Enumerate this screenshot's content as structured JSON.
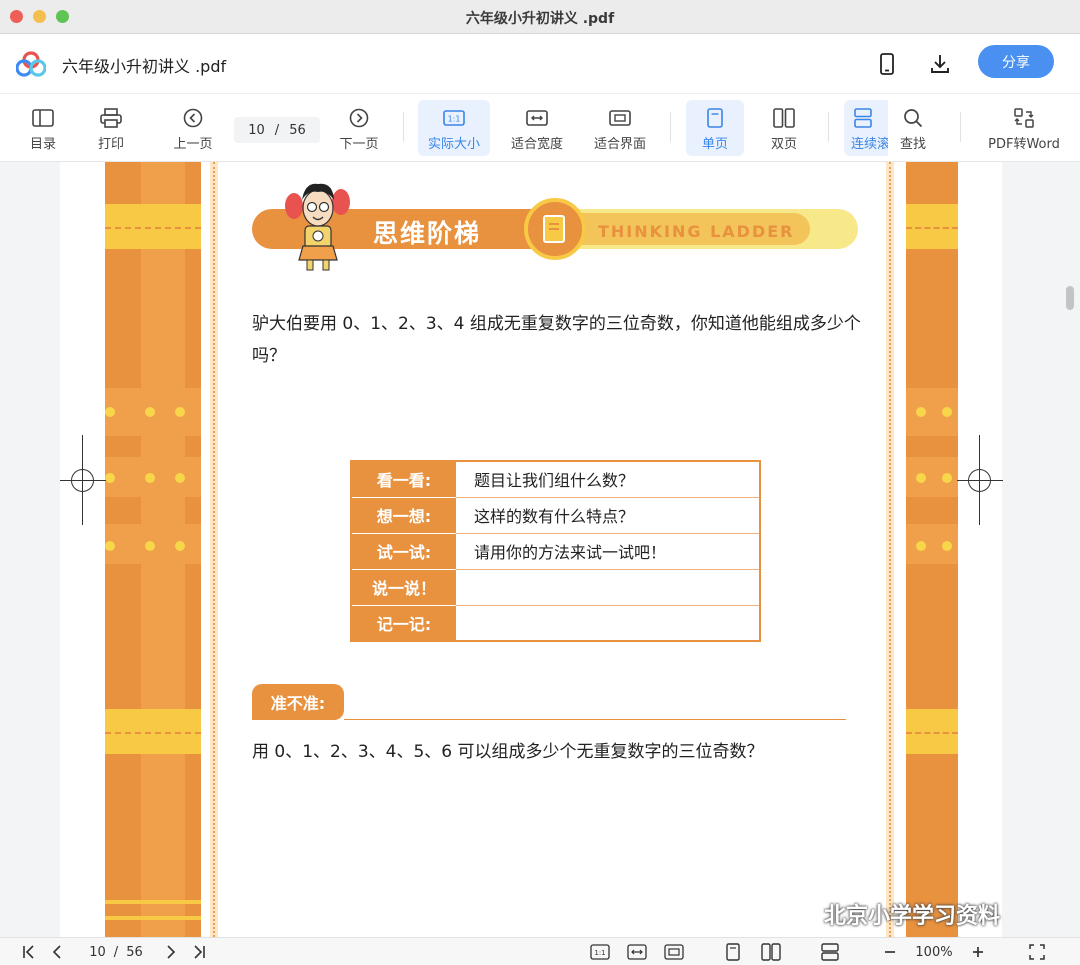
{
  "window": {
    "title": "六年级小升初讲义 .pdf"
  },
  "header": {
    "doc_title": "六年级小升初讲义 .pdf",
    "share_label": "分享",
    "icons": [
      "app-logo-icon",
      "phone-icon",
      "download-icon"
    ]
  },
  "toolbar": {
    "toc": "目录",
    "print": "打印",
    "prev_page": "上一页",
    "current_page": "10",
    "page_sep": "/",
    "total_pages": "56",
    "next_page": "下一页",
    "actual_size": "实际大小",
    "fit_width": "适合宽度",
    "fit_window": "适合界面",
    "single_page": "单页",
    "double_page": "双页",
    "continuous": "连续滚",
    "find": "查找",
    "pdf_to_word": "PDF转Word"
  },
  "content": {
    "banner_title": "思维阶梯",
    "banner_en": "THINKING LADDER",
    "question": "驴大伯要用 0、1、2、3、4 组成无重复数字的三位奇数，你知道他能组成多少个吗？",
    "steps": [
      {
        "key": "看一看:",
        "value": "题目让我们组什么数？"
      },
      {
        "key": "想一想:",
        "value": "这样的数有什么特点？"
      },
      {
        "key": "试一试:",
        "value": "请用你的方法来试一试吧！"
      },
      {
        "key": "说一说！",
        "value": ""
      },
      {
        "key": "记一记:",
        "value": ""
      }
    ],
    "section_tag": "准不准:",
    "practice": "用 0、1、2、3、4、5、6 可以组成多少个无重复数字的三位奇数？"
  },
  "watermark": "北京小学学习资料",
  "statusbar": {
    "current_page": "10",
    "page_sep": "/",
    "total_pages": "56",
    "zoom": "100%"
  },
  "colors": {
    "accent": "#4a90f0",
    "page_orange": "#e8913e",
    "page_yellow": "#f7c945"
  }
}
